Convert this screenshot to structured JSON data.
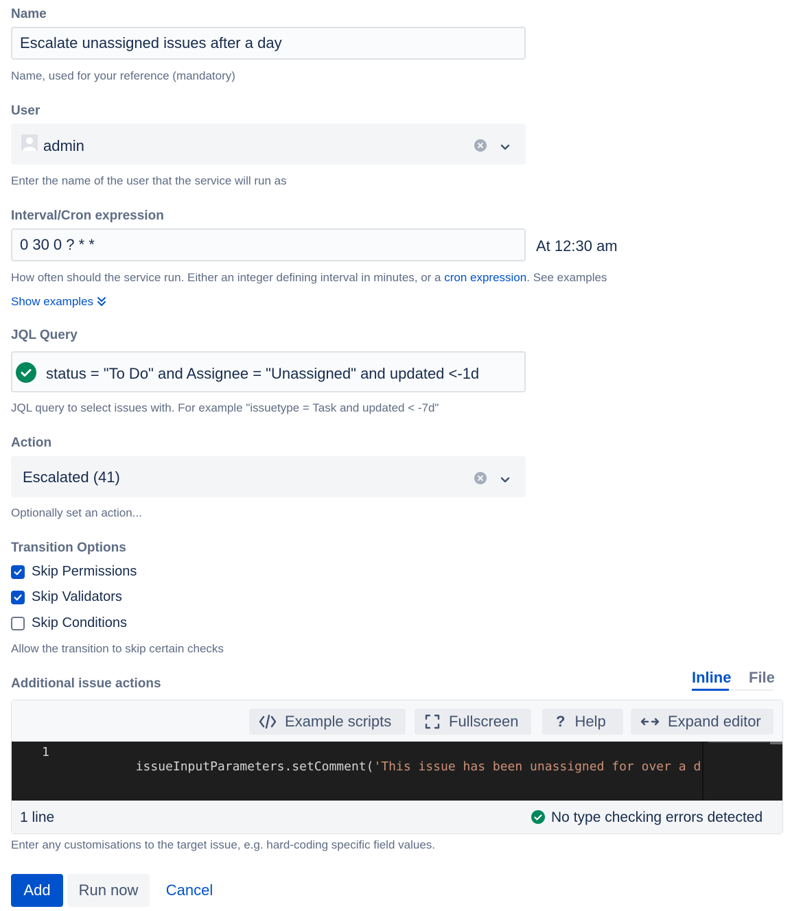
{
  "name_field": {
    "label": "Name",
    "value": "Escalate unassigned issues after a day",
    "help": "Name, used for your reference (mandatory)"
  },
  "user_field": {
    "label": "User",
    "value": "admin",
    "help": "Enter the name of the user that the service will run as"
  },
  "interval_field": {
    "label": "Interval/Cron expression",
    "value": "0 30 0 ? * *",
    "description": "At 12:30 am",
    "help_prefix": "How often should the service run. Either an integer defining interval in minutes, or a ",
    "help_link": "cron expression",
    "help_suffix": ". See examples",
    "show_examples": "Show examples"
  },
  "jql_field": {
    "label": "JQL Query",
    "value": "status = \"To Do\" and Assignee = \"Unassigned\" and updated <-1d",
    "help": "JQL query to select issues with. For example \"issuetype = Task and updated < -7d\""
  },
  "action_field": {
    "label": "Action",
    "value": "Escalated (41)",
    "help": "Optionally set an action..."
  },
  "transition_options": {
    "label": "Transition Options",
    "items": [
      {
        "label": "Skip Permissions",
        "checked": true
      },
      {
        "label": "Skip Validators",
        "checked": true
      },
      {
        "label": "Skip Conditions",
        "checked": false
      }
    ],
    "help": "Allow the transition to skip certain checks"
  },
  "additional_actions": {
    "label": "Additional issue actions",
    "tabs": [
      {
        "label": "Inline",
        "active": true
      },
      {
        "label": "File",
        "active": false
      }
    ],
    "toolbar": {
      "example_scripts": "Example scripts",
      "fullscreen": "Fullscreen",
      "help": "Help",
      "expand_editor": "Expand editor"
    },
    "code": {
      "line_number": "1",
      "code_prefix": "issueInputParameters.setComment(",
      "code_string": "'This issue has been unassigned for over a day so we"
    },
    "status": {
      "line_count": "1 line",
      "type_check": "No type checking errors detected"
    },
    "help": "Enter any customisations to the target issue, e.g. hard-coding specific field values."
  },
  "buttons": {
    "add": "Add",
    "run_now": "Run now",
    "cancel": "Cancel"
  },
  "colors": {
    "primary": "#0052cc",
    "success": "#00875a",
    "editor_bg": "#1e1e1e",
    "string": "#ce9178"
  }
}
